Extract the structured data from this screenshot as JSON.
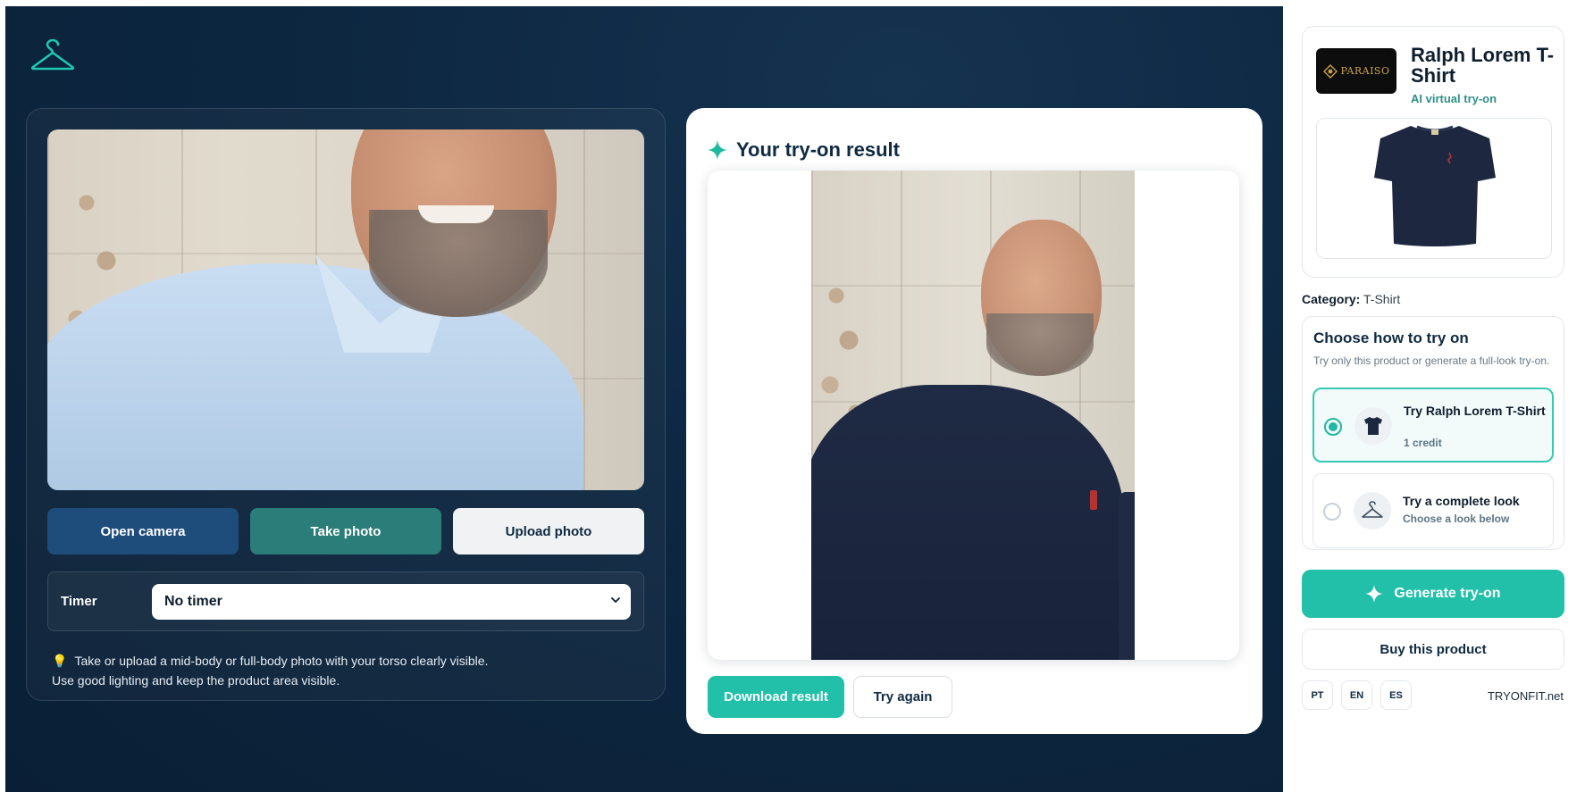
{
  "app": {
    "logo_icon": "hanger-icon"
  },
  "capture": {
    "open_camera": "Open camera",
    "take_photo": "Take photo",
    "upload_photo": "Upload photo",
    "timer_label": "Timer",
    "timer_value": "No timer",
    "tip_icon": "lightbulb-icon",
    "tip_line1": "Take or upload a mid-body or full-body photo with your torso clearly visible.",
    "tip_line2": "Use good lighting and keep the product area visible."
  },
  "result": {
    "title": "Your try-on result",
    "title_icon": "sparkle-icon",
    "download": "Download result",
    "try_again": "Try again"
  },
  "product": {
    "brand_logo_text": "PARAISO",
    "name": "Ralph Lorem T-Shirt",
    "subtitle": "AI virtual try-on",
    "category_label": "Category:",
    "category_value": "T-Shirt"
  },
  "choose": {
    "title": "Choose how to try on",
    "subtitle": "Try only this product or generate a full-look try-on.",
    "options": [
      {
        "name": "Try Ralph Lorem T-Shirt",
        "meta": "1 credit",
        "icon": "tshirt-icon",
        "selected": true
      },
      {
        "name": "Try a complete look",
        "meta": "Choose a look below",
        "icon": "hanger-icon",
        "selected": false
      }
    ]
  },
  "actions": {
    "generate": "Generate try-on",
    "buy": "Buy this product"
  },
  "footer": {
    "languages": [
      "PT",
      "EN",
      "ES"
    ],
    "site": "TRYONFIT.net"
  },
  "colors": {
    "accent": "#22c0a8",
    "navy": "#0d2741",
    "button_dark": "#1e4d7c",
    "button_teal": "#2a7d78"
  }
}
